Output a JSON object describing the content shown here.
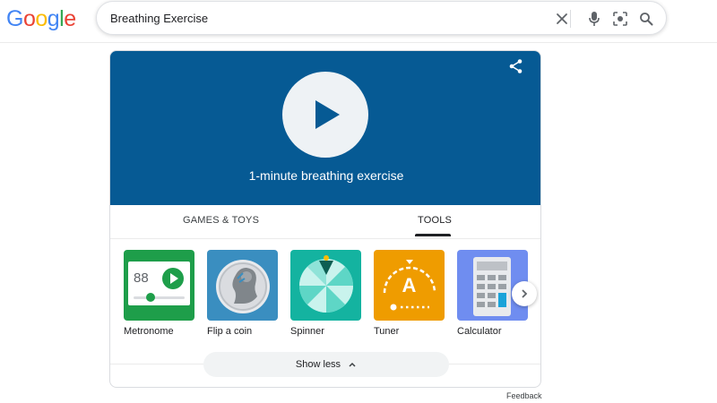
{
  "header": {
    "logo_letters": [
      {
        "ch": "G",
        "color": "#4285f4"
      },
      {
        "ch": "o",
        "color": "#ea4335"
      },
      {
        "ch": "o",
        "color": "#fbbc05"
      },
      {
        "ch": "g",
        "color": "#4285f4"
      },
      {
        "ch": "l",
        "color": "#34a853"
      },
      {
        "ch": "e",
        "color": "#ea4335"
      }
    ],
    "search_value": "Breathing Exercise",
    "icons": [
      "clear-icon",
      "microphone-icon",
      "lens-icon",
      "search-icon"
    ]
  },
  "hero": {
    "title": "1-minute breathing exercise",
    "background": "#065a94",
    "icons": [
      "play-icon",
      "share-icon"
    ]
  },
  "tabs": {
    "games_toys": "GAMES & TOYS",
    "tools": "TOOLS",
    "active": "tools"
  },
  "tools": [
    {
      "label": "Metronome",
      "color": "#1e9e4a",
      "value": "88",
      "icon": "metronome-icon"
    },
    {
      "label": "Flip a coin",
      "color": "#3a8ec0",
      "icon": "coin-icon"
    },
    {
      "label": "Spinner",
      "color": "#14b3a0",
      "icon": "spinner-icon"
    },
    {
      "label": "Tuner",
      "color": "#ef9c00",
      "note": "A",
      "icon": "tuner-icon"
    },
    {
      "label": "Calculator",
      "color": "#6f8df0",
      "icon": "calculator-icon"
    }
  ],
  "actions": {
    "show_less": "Show less",
    "feedback": "Feedback"
  }
}
